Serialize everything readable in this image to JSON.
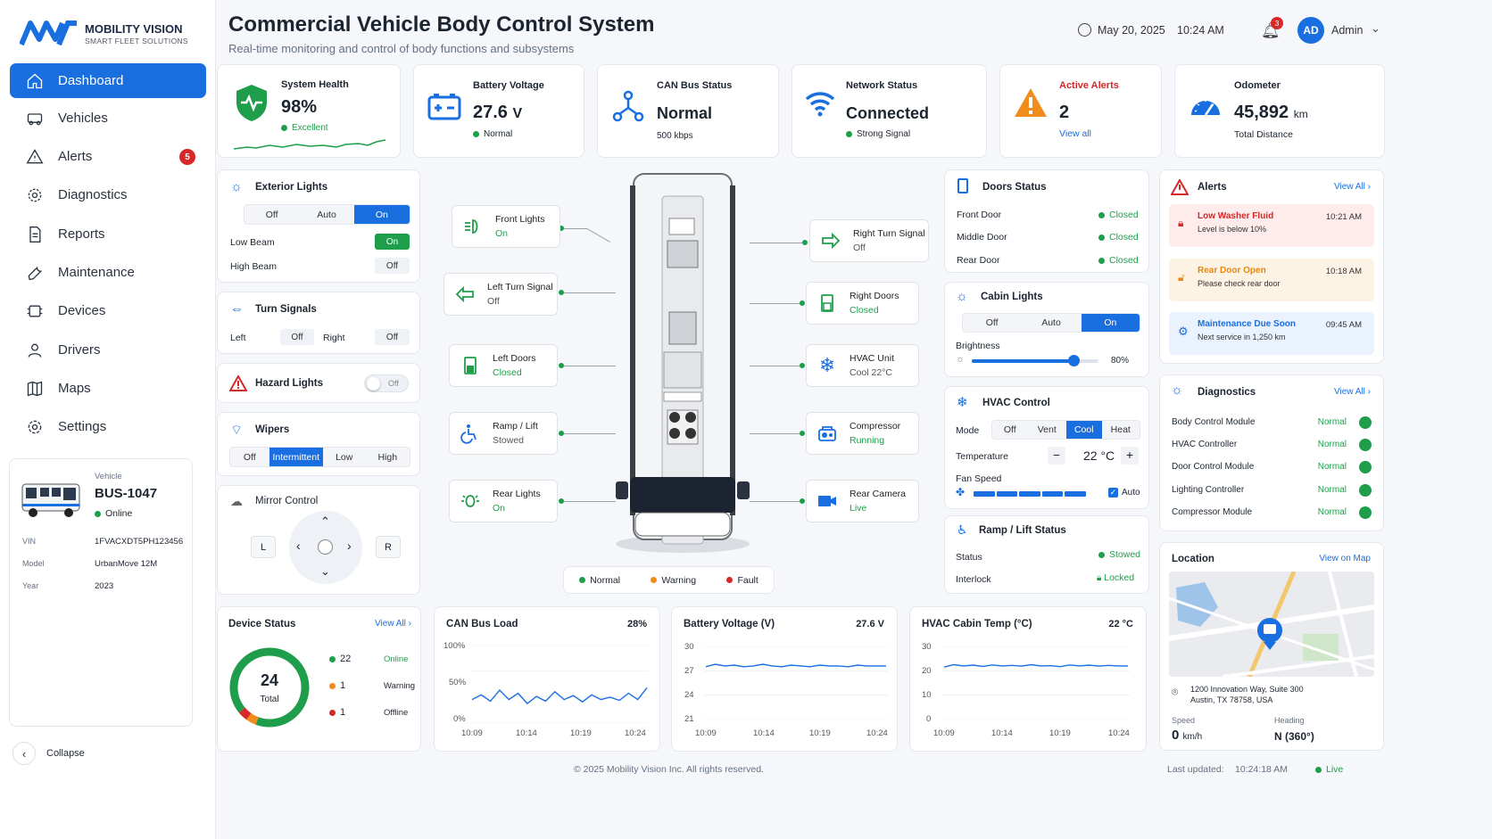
{
  "brand": {
    "name": "MOBILITY VISION",
    "tagline": "SMART FLEET SOLUTIONS"
  },
  "header": {
    "title": "Commercial Vehicle Body Control System",
    "subtitle": "Real-time monitoring and control of body functions and subsystems",
    "date": "May 20, 2025",
    "time": "10:24 AM",
    "notif_count": "3",
    "avatar": "AD",
    "user": "Admin"
  },
  "nav": [
    {
      "label": "Dashboard"
    },
    {
      "label": "Vehicles"
    },
    {
      "label": "Alerts",
      "badge": "5"
    },
    {
      "label": "Diagnostics"
    },
    {
      "label": "Reports"
    },
    {
      "label": "Maintenance"
    },
    {
      "label": "Devices"
    },
    {
      "label": "Drivers"
    },
    {
      "label": "Maps"
    },
    {
      "label": "Settings"
    }
  ],
  "vehicle": {
    "label": "Vehicle",
    "id": "BUS-1047",
    "status": "Online",
    "vin_label": "VIN",
    "vin": "1FVACXDT5PH123456",
    "model_label": "Model",
    "model": "UrbanMove 12M",
    "year_label": "Year",
    "year": "2023"
  },
  "collapse": "Collapse",
  "kpis": {
    "health": {
      "label": "System Health",
      "value": "98%",
      "status": "Excellent"
    },
    "battery": {
      "label": "Battery Voltage",
      "value": "27.6",
      "unit": "V",
      "status": "Normal"
    },
    "can": {
      "label": "CAN Bus Status",
      "value": "Normal",
      "sub": "500 kbps"
    },
    "network": {
      "label": "Network Status",
      "value": "Connected",
      "status": "Strong Signal"
    },
    "alerts": {
      "label": "Active Alerts",
      "value": "2",
      "link": "View all"
    },
    "odometer": {
      "label": "Odometer",
      "value": "45,892",
      "unit": "km",
      "sub": "Total Distance"
    }
  },
  "exterior": {
    "title": "Exterior Lights",
    "modes": [
      "Off",
      "Auto",
      "On"
    ],
    "low_beam": "Low Beam",
    "low_state": "On",
    "high_beam": "High Beam",
    "high_state": "Off"
  },
  "turn": {
    "title": "Turn Signals",
    "left": "Left",
    "left_state": "Off",
    "right": "Right",
    "right_state": "Off"
  },
  "hazard": {
    "title": "Hazard Lights",
    "state": "Off"
  },
  "wipers": {
    "title": "Wipers",
    "modes": [
      "Off",
      "Intermittent",
      "Low",
      "High"
    ]
  },
  "mirror": {
    "title": "Mirror Control",
    "left": "L",
    "right": "R"
  },
  "components": {
    "front_lights": {
      "name": "Front Lights",
      "state": "On"
    },
    "left_turn": {
      "name": "Left Turn Signal",
      "state": "Off"
    },
    "left_doors": {
      "name": "Left Doors",
      "state": "Closed"
    },
    "ramp": {
      "name": "Ramp / Lift",
      "state": "Stowed"
    },
    "rear_lights": {
      "name": "Rear Lights",
      "state": "On"
    },
    "right_turn": {
      "name": "Right Turn Signal",
      "state": "Off"
    },
    "right_doors": {
      "name": "Right Doors",
      "state": "Closed"
    },
    "hvac_unit": {
      "name": "HVAC Unit",
      "state": "Cool 22°C"
    },
    "compressor": {
      "name": "Compressor",
      "state": "Running"
    },
    "rear_camera": {
      "name": "Rear Camera",
      "state": "Live"
    }
  },
  "legend": {
    "normal": "Normal",
    "warning": "Warning",
    "fault": "Fault"
  },
  "doors": {
    "title": "Doors Status",
    "items": [
      {
        "name": "Front Door",
        "state": "Closed"
      },
      {
        "name": "Middle Door",
        "state": "Closed"
      },
      {
        "name": "Rear Door",
        "state": "Closed"
      }
    ]
  },
  "cabin": {
    "title": "Cabin Lights",
    "modes": [
      "Off",
      "Auto",
      "On"
    ],
    "brightness_label": "Brightness",
    "brightness": "80%",
    "brightness_level": 0.8
  },
  "hvac": {
    "title": "HVAC Control",
    "mode_label": "Mode",
    "modes": [
      "Off",
      "Vent",
      "Cool",
      "Heat"
    ],
    "temp_label": "Temperature",
    "temp": "22 °C",
    "fan_label": "Fan Speed",
    "auto": "Auto"
  },
  "ramp_status": {
    "title": "Ramp / Lift Status",
    "status_label": "Status",
    "status": "Stowed",
    "interlock_label": "Interlock",
    "interlock": "Locked"
  },
  "alerts_panel": {
    "title": "Alerts",
    "link": "View All ›",
    "items": [
      {
        "title": "Low Washer Fluid",
        "desc": "Level is below 10%",
        "time": "10:21 AM",
        "color": "#d62828",
        "bg": "#fdeceb"
      },
      {
        "title": "Rear Door Open",
        "desc": "Please check rear door",
        "time": "10:18 AM",
        "color": "#e8860c",
        "bg": "#fdf3e4"
      },
      {
        "title": "Maintenance Due Soon",
        "desc": "Next service in 1,250 km",
        "time": "09:45 AM",
        "color": "#1a6fe0",
        "bg": "#eaf2fd"
      }
    ]
  },
  "diagnostics": {
    "title": "Diagnostics",
    "link": "View All ›",
    "items": [
      {
        "name": "Body Control Module",
        "state": "Normal"
      },
      {
        "name": "HVAC Controller",
        "state": "Normal"
      },
      {
        "name": "Door Control Module",
        "state": "Normal"
      },
      {
        "name": "Lighting Controller",
        "state": "Normal"
      },
      {
        "name": "Compressor Module",
        "state": "Normal"
      }
    ]
  },
  "location": {
    "title": "Location",
    "link": "View on Map",
    "address1": "1200 Innovation Way, Suite 300",
    "address2": "Austin, TX 78758, USA",
    "speed_label": "Speed",
    "speed": "0",
    "speed_unit": "km/h",
    "heading_label": "Heading",
    "heading": "N (360°)"
  },
  "device_status": {
    "title": "Device Status",
    "link": "View All ›",
    "total": "24",
    "total_label": "Total",
    "online": "22",
    "online_label": "Online",
    "warning": "1",
    "warning_label": "Warning",
    "offline": "1",
    "offline_label": "Offline"
  },
  "charts": {
    "can": {
      "title": "CAN Bus Load",
      "value": "28%",
      "yticks": [
        "100%",
        "50%",
        "0%"
      ]
    },
    "battery": {
      "title": "Battery Voltage (V)",
      "value": "27.6 V",
      "yticks": [
        "30",
        "27",
        "24",
        "21"
      ]
    },
    "hvac": {
      "title": "HVAC Cabin Temp (°C)",
      "value": "22 °C",
      "yticks": [
        "30",
        "20",
        "10",
        "0"
      ]
    },
    "xticks": [
      "10:09",
      "10:14",
      "10:19",
      "10:24"
    ]
  },
  "chart_data": [
    {
      "type": "line",
      "title": "CAN Bus Load",
      "x": [
        "10:09",
        "10:14",
        "10:19",
        "10:24"
      ],
      "ylim": [
        0,
        100
      ],
      "series": [
        {
          "values": [
            30,
            36,
            28,
            42,
            30,
            38,
            25,
            34,
            28,
            40,
            30,
            35,
            27,
            36,
            30,
            33,
            29,
            38,
            30,
            45
          ]
        }
      ]
    },
    {
      "type": "line",
      "title": "Battery Voltage (V)",
      "x": [
        "10:09",
        "10:14",
        "10:19",
        "10:24"
      ],
      "ylim": [
        21,
        30
      ],
      "series": [
        {
          "values": [
            27.5,
            27.8,
            27.6,
            27.7,
            27.5,
            27.6,
            27.8,
            27.6,
            27.5,
            27.7,
            27.6,
            27.5,
            27.7,
            27.6,
            27.6,
            27.5,
            27.7,
            27.6,
            27.6,
            27.6
          ]
        }
      ]
    },
    {
      "type": "line",
      "title": "HVAC Cabin Temp (°C)",
      "x": [
        "10:09",
        "10:14",
        "10:19",
        "10:24"
      ],
      "ylim": [
        0,
        30
      ],
      "series": [
        {
          "values": [
            21.5,
            22.5,
            22,
            22.3,
            21.8,
            22.4,
            22,
            22.2,
            21.9,
            22.5,
            22,
            22.1,
            21.7,
            22.4,
            22,
            22.3,
            21.9,
            22.2,
            22,
            22
          ]
        }
      ]
    }
  ],
  "footer": {
    "copyright": "© 2025 Mobility Vision Inc. All rights reserved.",
    "updated_label": "Last updated:",
    "updated": "10:24:18 AM",
    "live": "Live"
  }
}
